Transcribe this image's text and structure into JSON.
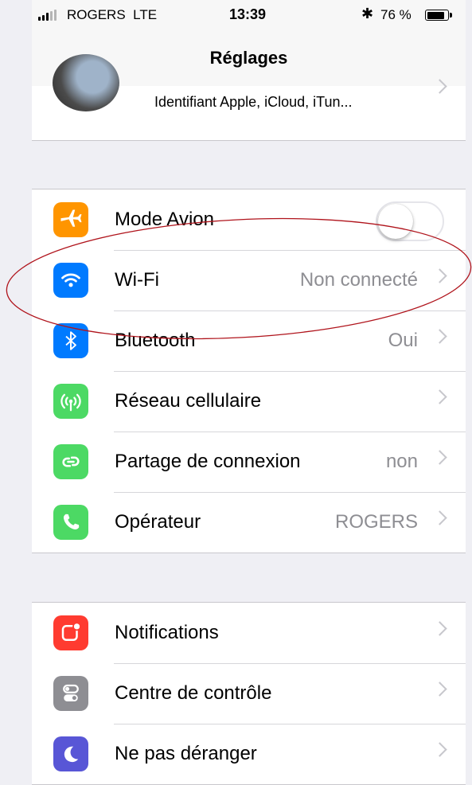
{
  "status_bar": {
    "carrier": "ROGERS",
    "network": "LTE",
    "time": "13:39",
    "bluetooth_glyph": "✱",
    "battery_text": "76 %",
    "battery_level": 0.76
  },
  "nav": {
    "title": "Réglages"
  },
  "profile": {
    "subtitle": "Identifiant Apple, iCloud, iTun..."
  },
  "group1": [
    {
      "label": "Mode Avion",
      "value": "",
      "icon": "airplane-icon",
      "color": "#ff9500",
      "toggle": false
    },
    {
      "label": "Wi-Fi",
      "value": "Non connecté",
      "icon": "wifi-icon",
      "color": "#007aff"
    },
    {
      "label": "Bluetooth",
      "value": "Oui",
      "icon": "bluetooth-icon",
      "color": "#007aff"
    },
    {
      "label": "Réseau cellulaire",
      "value": "",
      "icon": "cellular-antenna-icon",
      "color": "#4cd964"
    },
    {
      "label": "Partage de connexion",
      "value": "non",
      "icon": "hotspot-link-icon",
      "color": "#4cd964"
    },
    {
      "label": "Opérateur",
      "value": "ROGERS",
      "icon": "phone-icon",
      "color": "#4cd964"
    }
  ],
  "group2": [
    {
      "label": "Notifications",
      "icon": "notifications-icon",
      "color": "#ff3b30"
    },
    {
      "label": "Centre de contrôle",
      "icon": "control-center-icon",
      "color": "#8e8e93"
    },
    {
      "label": "Ne pas déranger",
      "icon": "moon-icon",
      "color": "#5856d6"
    }
  ],
  "annotation": {
    "color": "#b0141c"
  }
}
